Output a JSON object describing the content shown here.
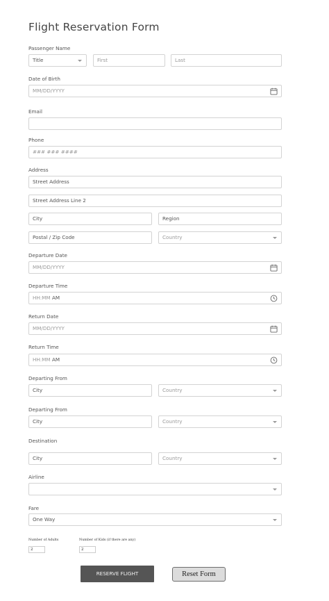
{
  "form": {
    "title": "Flight Reservation Form"
  },
  "passenger": {
    "label": "Passenger Name",
    "title_select": "Title",
    "first_ph": "First",
    "last_ph": "Last"
  },
  "dob": {
    "label": "Date of Birth",
    "placeholder": "MM/DD/YYYY"
  },
  "email": {
    "label": "Email",
    "value": ""
  },
  "phone": {
    "label": "Phone",
    "placeholder": "### ### ####"
  },
  "address": {
    "label": "Address",
    "street": "Street Address",
    "street2": "Street Address Line 2",
    "city": "City",
    "region": "Region",
    "postal": "Postal / Zip Code",
    "country": "Country"
  },
  "departure_date": {
    "label": "Departure Date",
    "placeholder": "MM/DD/YYYY"
  },
  "departure_time": {
    "label": "Departure Time",
    "placeholder": "HH:MM",
    "ampm": "AM"
  },
  "return_date": {
    "label": "Return Date",
    "placeholder": "MM/DD/YYYY"
  },
  "return_time": {
    "label": "Return Time",
    "placeholder": "HH:MM",
    "ampm": "AM"
  },
  "departing_from_1": {
    "label": "Departing From",
    "city": "City",
    "country": "Country"
  },
  "departing_from_2": {
    "label": "Departing From",
    "city": "City",
    "country": "Country"
  },
  "destination": {
    "label": "Destination",
    "city": "City",
    "country": "Country"
  },
  "airline": {
    "label": "Airline",
    "value": ""
  },
  "fare": {
    "label": "Fare",
    "value": "One Way"
  },
  "adults": {
    "label": "Number of Adults",
    "value": "2"
  },
  "kids": {
    "label": "Number of Kids (if there are any)",
    "value": "2"
  },
  "buttons": {
    "reserve": "RESERVE FLIGHT",
    "reset": "Reset Form"
  },
  "icons": {
    "date": "calendar-icon",
    "time": "clock-icon",
    "select": "chevron-down-icon"
  }
}
